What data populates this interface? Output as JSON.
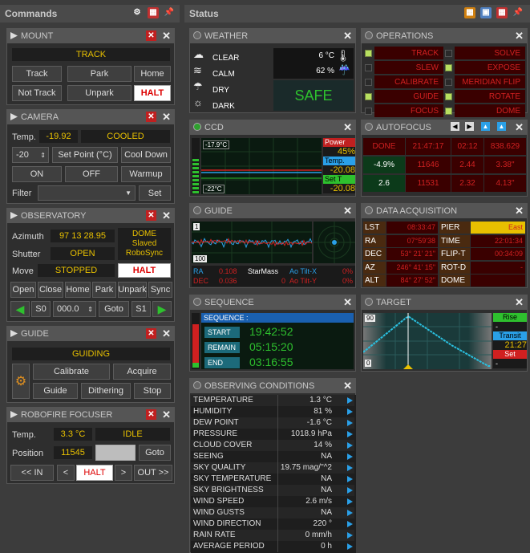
{
  "commands": {
    "title": "Commands"
  },
  "status": {
    "title": "Status"
  },
  "mount": {
    "title": "MOUNT",
    "state": "TRACK",
    "track": "Track",
    "park": "Park",
    "home": "Home",
    "not_track": "Not Track",
    "unpark": "Unpark",
    "halt": "HALT"
  },
  "camera": {
    "title": "CAMERA",
    "temp_label": "Temp.",
    "temp": "-19.92",
    "state": "COOLED",
    "setpoint": "-20",
    "set_point_btn": "Set Point (°C)",
    "cool_down": "Cool Down",
    "on": "ON",
    "off": "OFF",
    "warmup": "Warmup",
    "filter_label": "Filter",
    "set": "Set"
  },
  "observatory": {
    "title": "OBSERVATORY",
    "azimuth_label": "Azimuth",
    "azimuth": "97 13 28.95",
    "dome": "DOME",
    "slaved": "Slaved",
    "robosync": "RoboSync",
    "shutter_label": "Shutter",
    "shutter": "OPEN",
    "move_label": "Move",
    "move": "STOPPED",
    "halt": "HALT",
    "open": "Open",
    "close": "Close",
    "home": "Home",
    "park": "Park",
    "unpark": "Unpark",
    "sync": "Sync",
    "s0": "S0",
    "deg": "000.0",
    "goto": "Goto",
    "s1": "S1"
  },
  "guide_cmd": {
    "title": "GUIDE",
    "state": "GUIDING",
    "calibrate": "Calibrate",
    "acquire": "Acquire",
    "guide": "Guide",
    "dithering": "Dithering",
    "stop": "Stop"
  },
  "focuser": {
    "title": "ROBOFIRE FOCUSER",
    "temp_label": "Temp.",
    "temp": "3.3 °C",
    "state": "IDLE",
    "position_label": "Position",
    "position": "11545",
    "goto": "Goto",
    "in": "<< IN",
    "lt": "<",
    "halt": "HALT",
    "gt": ">",
    "out": "OUT >>"
  },
  "weather": {
    "title": "WEATHER",
    "rows": [
      "CLEAR",
      "CALM",
      "DRY",
      "DARK"
    ],
    "temp": "6 °C",
    "humidity": "62 %",
    "safe": "SAFE"
  },
  "operations": {
    "title": "OPERATIONS",
    "left": [
      {
        "label": "TRACK",
        "on": true
      },
      {
        "label": "SLEW",
        "on": false
      },
      {
        "label": "CALIBRATE",
        "on": false
      },
      {
        "label": "GUIDE",
        "on": true
      },
      {
        "label": "FOCUS",
        "on": false
      }
    ],
    "right": [
      {
        "label": "SOLVE",
        "on": false
      },
      {
        "label": "EXPOSE",
        "on": true
      },
      {
        "label": "MERIDIAN FLIP",
        "on": false
      },
      {
        "label": "ROTATE",
        "on": true
      },
      {
        "label": "DOME",
        "on": true
      }
    ]
  },
  "ccd": {
    "title": "CCD",
    "top_temp": "-17.9°C",
    "bottom_temp": "-22°C",
    "power": "Power",
    "power_val": "45%",
    "temp": "Temp.",
    "temp_val": "-20.08",
    "set_t": "Set T",
    "set_t_val": "-20.08"
  },
  "autofocus": {
    "title": "AUTOFOCUS",
    "row1": [
      "DONE",
      "21:47:17",
      "02:12",
      "838.629"
    ],
    "row2": [
      "-4.9%",
      "11646",
      "2.44",
      "3.38\""
    ],
    "row3": [
      "2.6",
      "11531",
      "2.32",
      "4.13\""
    ]
  },
  "guide_stat": {
    "title": "GUIDE",
    "y_top": "1",
    "y_bot": "100",
    "ra": "RA",
    "ra_val": "0.108",
    "dec": "DEC",
    "dec_val": "0.036",
    "starmass": "StarMass",
    "starmass_val": "0",
    "ao_x": "Ao Tilt-X",
    "ao_x_val": "0%",
    "ao_y": "Ao Tilt-Y",
    "ao_y_val": "0%"
  },
  "acq": {
    "title": "DATA ACQUISITION",
    "rows": [
      {
        "k": "LST",
        "v": "08:33:47",
        "k2": "PIER",
        "v2": "East"
      },
      {
        "k": "RA",
        "v": "07°59'38",
        "k2": "TIME",
        "v2": "22:01:34"
      },
      {
        "k": "DEC",
        "v": "53° 21' 21\"",
        "k2": "FLIP-T",
        "v2": "00:34:09"
      },
      {
        "k": "AZ",
        "v": "246° 41' 15\"",
        "k2": "ROT-D",
        "v2": "-"
      },
      {
        "k": "ALT",
        "v": "84° 27' 52\"",
        "k2": "DOME",
        "v2": ""
      }
    ]
  },
  "sequence": {
    "title": "SEQUENCE",
    "header": "SEQUENCE :",
    "start": "START",
    "start_val": "19:42:52",
    "remain": "REMAIN",
    "remain_val": "05:15:20",
    "end": "END",
    "end_val": "03:16:55"
  },
  "target": {
    "title": "TARGET",
    "y_top": "90",
    "y_bot": "0",
    "rise": "Rise",
    "rise_val": "-",
    "transit": "Transit",
    "transit_val": "21:27",
    "set": "Set",
    "set_val": "-"
  },
  "obs_cond": {
    "title": "OBSERVING CONDITIONS",
    "rows": [
      {
        "n": "TEMPERATURE",
        "v": "1.3 °C"
      },
      {
        "n": "HUMIDITY",
        "v": "81 %"
      },
      {
        "n": "DEW POINT",
        "v": "-1.6 °C"
      },
      {
        "n": "PRESSURE",
        "v": "1018.9 hPa"
      },
      {
        "n": "CLOUD COVER",
        "v": "14 %"
      },
      {
        "n": "SEEING",
        "v": "NA"
      },
      {
        "n": "SKY QUALITY",
        "v": "19.75 mag/''^2"
      },
      {
        "n": "SKY TEMPERATURE",
        "v": "NA"
      },
      {
        "n": "SKY BRIGHTNESS",
        "v": "NA"
      },
      {
        "n": "WIND SPEED",
        "v": "2.6 m/s"
      },
      {
        "n": "WIND GUSTS",
        "v": "NA"
      },
      {
        "n": "WIND DIRECTION",
        "v": "220 °"
      },
      {
        "n": "RAIN RATE",
        "v": "0 mm/h"
      },
      {
        "n": "AVERAGE PERIOD",
        "v": "0 h"
      }
    ]
  }
}
